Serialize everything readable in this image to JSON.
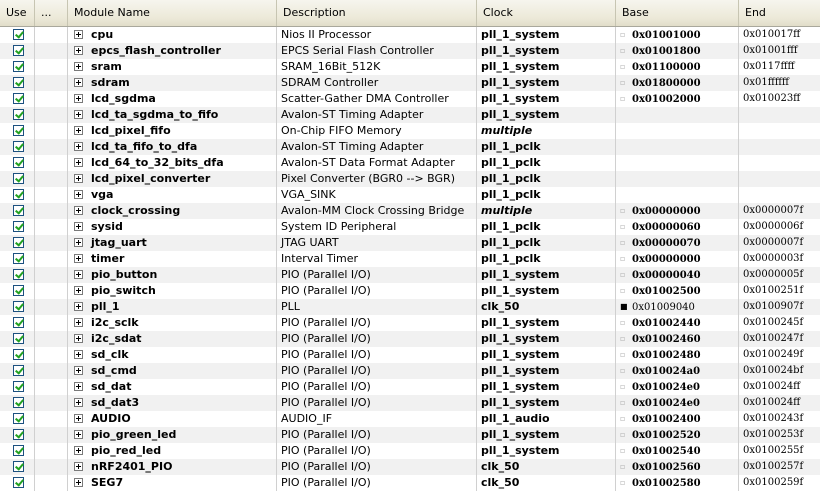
{
  "columns": {
    "use": "Use",
    "dots": "...",
    "module": "Module Name",
    "description": "Description",
    "clock": "Clock",
    "base": "Base",
    "end": "End"
  },
  "rows": [
    {
      "name": "cpu",
      "desc": "Nios II Processor",
      "clock": "pll_1_system",
      "base": "0x01001000",
      "end": "0x010017ff",
      "lock": "open",
      "clock_style": "normal"
    },
    {
      "name": "epcs_flash_controller",
      "desc": "EPCS Serial Flash Controller",
      "clock": "pll_1_system",
      "base": "0x01001800",
      "end": "0x01001fff",
      "lock": "open",
      "clock_style": "normal"
    },
    {
      "name": "sram",
      "desc": "SRAM_16Bit_512K",
      "clock": "pll_1_system",
      "base": "0x01100000",
      "end": "0x0117ffff",
      "lock": "open",
      "clock_style": "normal"
    },
    {
      "name": "sdram",
      "desc": "SDRAM Controller",
      "clock": "pll_1_system",
      "base": "0x01800000",
      "end": "0x01ffffff",
      "lock": "open",
      "clock_style": "normal"
    },
    {
      "name": "lcd_sgdma",
      "desc": "Scatter-Gather DMA Controller",
      "clock": "pll_1_system",
      "base": "0x01002000",
      "end": "0x010023ff",
      "lock": "open",
      "clock_style": "normal"
    },
    {
      "name": "lcd_ta_sgdma_to_fifo",
      "desc": "Avalon-ST Timing Adapter",
      "clock": "pll_1_system",
      "base": "",
      "end": "",
      "lock": "none",
      "clock_style": "normal"
    },
    {
      "name": "lcd_pixel_fifo",
      "desc": "On-Chip FIFO Memory",
      "clock": "multiple",
      "base": "",
      "end": "",
      "lock": "none",
      "clock_style": "multiple"
    },
    {
      "name": "lcd_ta_fifo_to_dfa",
      "desc": "Avalon-ST Timing Adapter",
      "clock": "pll_1_pclk",
      "base": "",
      "end": "",
      "lock": "none",
      "clock_style": "normal"
    },
    {
      "name": "lcd_64_to_32_bits_dfa",
      "desc": "Avalon-ST Data Format Adapter",
      "clock": "pll_1_pclk",
      "base": "",
      "end": "",
      "lock": "none",
      "clock_style": "normal"
    },
    {
      "name": "lcd_pixel_converter",
      "desc": "Pixel Converter (BGR0 --> BGR)",
      "clock": "pll_1_pclk",
      "base": "",
      "end": "",
      "lock": "none",
      "clock_style": "normal"
    },
    {
      "name": "vga",
      "desc": "VGA_SINK",
      "clock": "pll_1_pclk",
      "base": "",
      "end": "",
      "lock": "none",
      "clock_style": "normal"
    },
    {
      "name": "clock_crossing",
      "desc": "Avalon-MM Clock Crossing Bridge",
      "clock": "multiple",
      "base": "0x00000000",
      "end": "0x0000007f",
      "lock": "open",
      "clock_style": "multiple"
    },
    {
      "name": "sysid",
      "desc": "System ID Peripheral",
      "clock": "pll_1_pclk",
      "base": "0x00000060",
      "end": "0x0000006f",
      "lock": "open",
      "clock_style": "normal"
    },
    {
      "name": "jtag_uart",
      "desc": "JTAG UART",
      "clock": "pll_1_pclk",
      "base": "0x00000070",
      "end": "0x0000007f",
      "lock": "open",
      "clock_style": "normal"
    },
    {
      "name": "timer",
      "desc": "Interval Timer",
      "clock": "pll_1_pclk",
      "base": "0x00000000",
      "end": "0x0000003f",
      "lock": "open",
      "clock_style": "normal"
    },
    {
      "name": "pio_button",
      "desc": "PIO (Parallel I/O)",
      "clock": "pll_1_system",
      "base": "0x00000040",
      "end": "0x0000005f",
      "lock": "open",
      "clock_style": "normal"
    },
    {
      "name": "pio_switch",
      "desc": "PIO (Parallel I/O)",
      "clock": "pll_1_system",
      "base": "0x01002500",
      "end": "0x0100251f",
      "lock": "open",
      "clock_style": "normal"
    },
    {
      "name": "pll_1",
      "desc": "PLL",
      "clock": "clk_50",
      "base": "0x01009040",
      "end": "0x0100907f",
      "lock": "locked",
      "clock_style": "normal"
    },
    {
      "name": "i2c_sclk",
      "desc": "PIO (Parallel I/O)",
      "clock": "pll_1_system",
      "base": "0x01002440",
      "end": "0x0100245f",
      "lock": "open",
      "clock_style": "normal"
    },
    {
      "name": "i2c_sdat",
      "desc": "PIO (Parallel I/O)",
      "clock": "pll_1_system",
      "base": "0x01002460",
      "end": "0x0100247f",
      "lock": "open",
      "clock_style": "normal"
    },
    {
      "name": "sd_clk",
      "desc": "PIO (Parallel I/O)",
      "clock": "pll_1_system",
      "base": "0x01002480",
      "end": "0x0100249f",
      "lock": "open",
      "clock_style": "normal"
    },
    {
      "name": "sd_cmd",
      "desc": "PIO (Parallel I/O)",
      "clock": "pll_1_system",
      "base": "0x010024a0",
      "end": "0x010024bf",
      "lock": "open",
      "clock_style": "normal"
    },
    {
      "name": "sd_dat",
      "desc": "PIO (Parallel I/O)",
      "clock": "pll_1_system",
      "base": "0x010024e0",
      "end": "0x010024ff",
      "lock": "open",
      "clock_style": "normal"
    },
    {
      "name": "sd_dat3",
      "desc": "PIO (Parallel I/O)",
      "clock": "pll_1_system",
      "base": "0x010024e0",
      "end": "0x010024ff",
      "lock": "open",
      "clock_style": "normal"
    },
    {
      "name": "AUDIO",
      "desc": "AUDIO_IF",
      "clock": "pll_1_audio",
      "base": "0x01002400",
      "end": "0x0100243f",
      "lock": "open",
      "clock_style": "normal"
    },
    {
      "name": "pio_green_led",
      "desc": "PIO (Parallel I/O)",
      "clock": "pll_1_system",
      "base": "0x01002520",
      "end": "0x0100253f",
      "lock": "open",
      "clock_style": "normal"
    },
    {
      "name": "pio_red_led",
      "desc": "PIO (Parallel I/O)",
      "clock": "pll_1_system",
      "base": "0x01002540",
      "end": "0x0100255f",
      "lock": "open",
      "clock_style": "normal"
    },
    {
      "name": "nRF2401_PIO",
      "desc": "PIO (Parallel I/O)",
      "clock": "clk_50",
      "base": "0x01002560",
      "end": "0x0100257f",
      "lock": "open",
      "clock_style": "normal"
    },
    {
      "name": "SEG7",
      "desc": "PIO (Parallel I/O)",
      "clock": "clk_50",
      "base": "0x01002580",
      "end": "0x0100259f",
      "lock": "open",
      "clock_style": "normal"
    }
  ],
  "icons": {
    "checkbox": "checkbox-checked-icon",
    "expander": "expand-plus-icon",
    "lock_open": "unlocked-icon",
    "lock_closed": "lock-icon"
  }
}
